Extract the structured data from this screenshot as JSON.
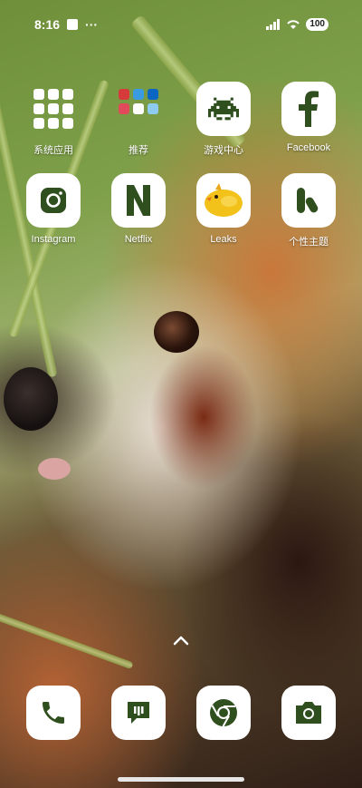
{
  "status_bar": {
    "time": "8:16",
    "extra": "···",
    "battery": "100"
  },
  "home": {
    "apps": [
      {
        "label": "系统应用",
        "icon": "app-folder-icon"
      },
      {
        "label": "推荐",
        "icon": "recommended-folder-icon"
      },
      {
        "label": "游戏中心",
        "icon": "space-invader-icon"
      },
      {
        "label": "Facebook",
        "icon": "facebook-icon"
      },
      {
        "label": "Instagram",
        "icon": "instagram-icon"
      },
      {
        "label": "Netflix",
        "icon": "netflix-icon"
      },
      {
        "label": "Leaks",
        "icon": "yellow-bird-icon"
      },
      {
        "label": "个性主题",
        "icon": "theme-icon"
      }
    ]
  },
  "dock": [
    {
      "icon": "phone-icon"
    },
    {
      "icon": "messages-icon"
    },
    {
      "icon": "chrome-icon"
    },
    {
      "icon": "camera-icon"
    }
  ],
  "colors": {
    "icon_green": "#2f4f1f",
    "icon_bg": "#ffffff"
  }
}
